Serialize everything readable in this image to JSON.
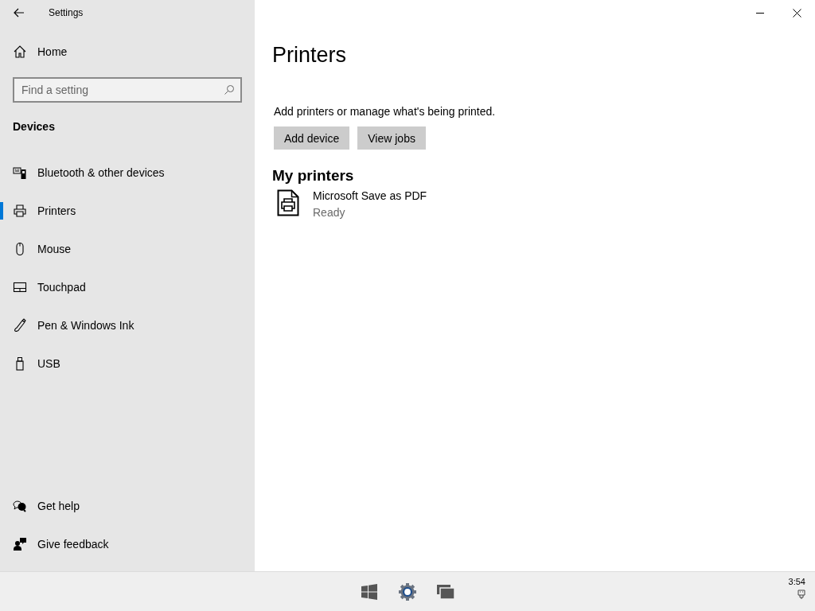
{
  "window": {
    "title": "Settings"
  },
  "sidebar": {
    "home": "Home",
    "search": {
      "placeholder": "Find a setting"
    },
    "section": "Devices",
    "items": [
      {
        "label": "Bluetooth & other devices",
        "selected": false
      },
      {
        "label": "Printers",
        "selected": true
      },
      {
        "label": "Mouse",
        "selected": false
      },
      {
        "label": "Touchpad",
        "selected": false
      },
      {
        "label": "Pen & Windows Ink",
        "selected": false
      },
      {
        "label": "USB",
        "selected": false
      }
    ],
    "footer": [
      "Get help",
      "Give feedback"
    ]
  },
  "page": {
    "title": "Printers",
    "description": "Add printers or manage what's being printed.",
    "buttons": [
      "Add device",
      "View jobs"
    ],
    "section": "My printers",
    "printers": [
      {
        "name": "Microsoft Save as PDF",
        "status": "Ready"
      }
    ]
  },
  "taskbar": {
    "clock": "3:54"
  }
}
